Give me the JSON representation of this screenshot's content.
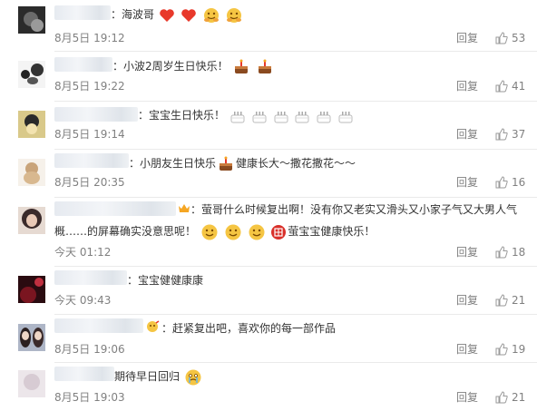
{
  "comments": [
    {
      "text": "海波哥",
      "date": "8月5日 19:12",
      "reply": "回复",
      "likes": "53"
    },
    {
      "text": "小波2周岁生日快乐！",
      "date": "8月5日 19:22",
      "reply": "回复",
      "likes": "41"
    },
    {
      "text": "宝宝生日快乐！",
      "date": "8月5日 19:14",
      "reply": "回复",
      "likes": "37"
    },
    {
      "text_a": "小朋友生日快乐",
      "text_b": "健康长大～撒花撒花～～",
      "date": "8月5日 20:35",
      "reply": "回复",
      "likes": "16"
    },
    {
      "line1": "萤哥什么时候复出啊！没有你又老实又滑头又小家子气又大男人气",
      "line2": "概……的屏幕确实没意思呢！",
      "line2_tail": "萤宝宝健康快乐！",
      "date": "今天 01:12",
      "reply": "回复",
      "likes": "18"
    },
    {
      "text": "宝宝健健康康",
      "date": "今天 09:43",
      "reply": "回复",
      "likes": "21"
    },
    {
      "text": "赶紧复出吧，喜欢你的每一部作品",
      "date": "8月5日 19:06",
      "reply": "回复",
      "likes": "19"
    },
    {
      "text": "期待早日回归",
      "date": "8月5日 19:03",
      "reply": "回复",
      "likes": "21"
    }
  ],
  "colors": {
    "accent_red": "#e8392b",
    "meta_gray": "#808080",
    "divider": "#eaeaea"
  },
  "icons": [
    "heart-emoji",
    "hug-emoji",
    "cake-emoji",
    "thumbs-up-icon",
    "smile-emoji",
    "blessing-badge",
    "teary-emoji",
    "vip-badge"
  ]
}
